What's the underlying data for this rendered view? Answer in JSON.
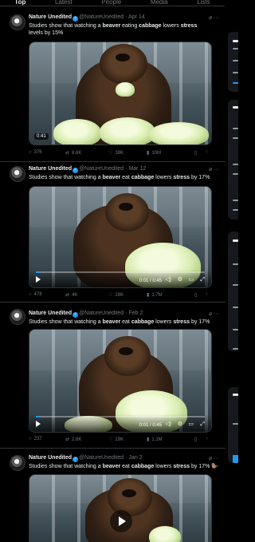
{
  "tabs": [
    "Top",
    "Latest",
    "People",
    "Media",
    "Lists"
  ],
  "account": {
    "name": "Nature Unedited",
    "handle": "@NatureUnedited"
  },
  "tweets": [
    {
      "date": "Apr 14",
      "text_a": "Studies show that watching a ",
      "kw1": "beaver",
      "text_b": " eating ",
      "kw2": "cabbage",
      "text_c": " lowers ",
      "kw3": "stress",
      "text_d": " levels by 15%",
      "video": {
        "duration": "0:41"
      },
      "stats": {
        "replies": "376",
        "reposts": "8.6K",
        "likes": "38K",
        "views": "10M"
      }
    },
    {
      "date": "Mar 12",
      "text_a": "Studies show that watching a ",
      "kw1": "beaver",
      "text_b": " eat ",
      "kw2": "cabbage",
      "text_c": " lowers ",
      "kw3": "stress",
      "text_d": " by 17%",
      "video": {
        "time": "0:01 / 0:45",
        "progress": 0.02
      },
      "stats": {
        "replies": "478",
        "reposts": "4K",
        "likes": "28K",
        "views": "1.7M"
      }
    },
    {
      "date": "Feb 2",
      "text_a": "Studies show that watching a ",
      "kw1": "beaver",
      "text_b": " eat ",
      "kw2": "cabbage",
      "text_c": " lowers ",
      "kw3": "stress",
      "text_d": " by 17%",
      "video": {
        "time": "0:01 / 0:45",
        "progress": 0.02
      },
      "stats": {
        "replies": "237",
        "reposts": "2.8K",
        "likes": "19K",
        "views": "1.1M"
      }
    },
    {
      "date": "Jan 2",
      "text_a": "Studies show that watching a ",
      "kw1": "beaver",
      "text_b": " eat ",
      "kw2": "cabbage",
      "text_c": " lowers ",
      "kw3": "stress",
      "text_d": " by 17% ",
      "emoji": "🦫"
    }
  ],
  "icons": {
    "reply": "reply-icon",
    "repost": "repost-icon",
    "like": "heart-icon",
    "views": "views-icon",
    "bookmark": "bookmark-icon",
    "share": "share-icon",
    "more": "more-icon",
    "grok": "grok-icon"
  },
  "colors": {
    "accent": "#1d9bf0",
    "background": "#000000",
    "muted": "#71767b",
    "text": "#e7e9ea"
  }
}
